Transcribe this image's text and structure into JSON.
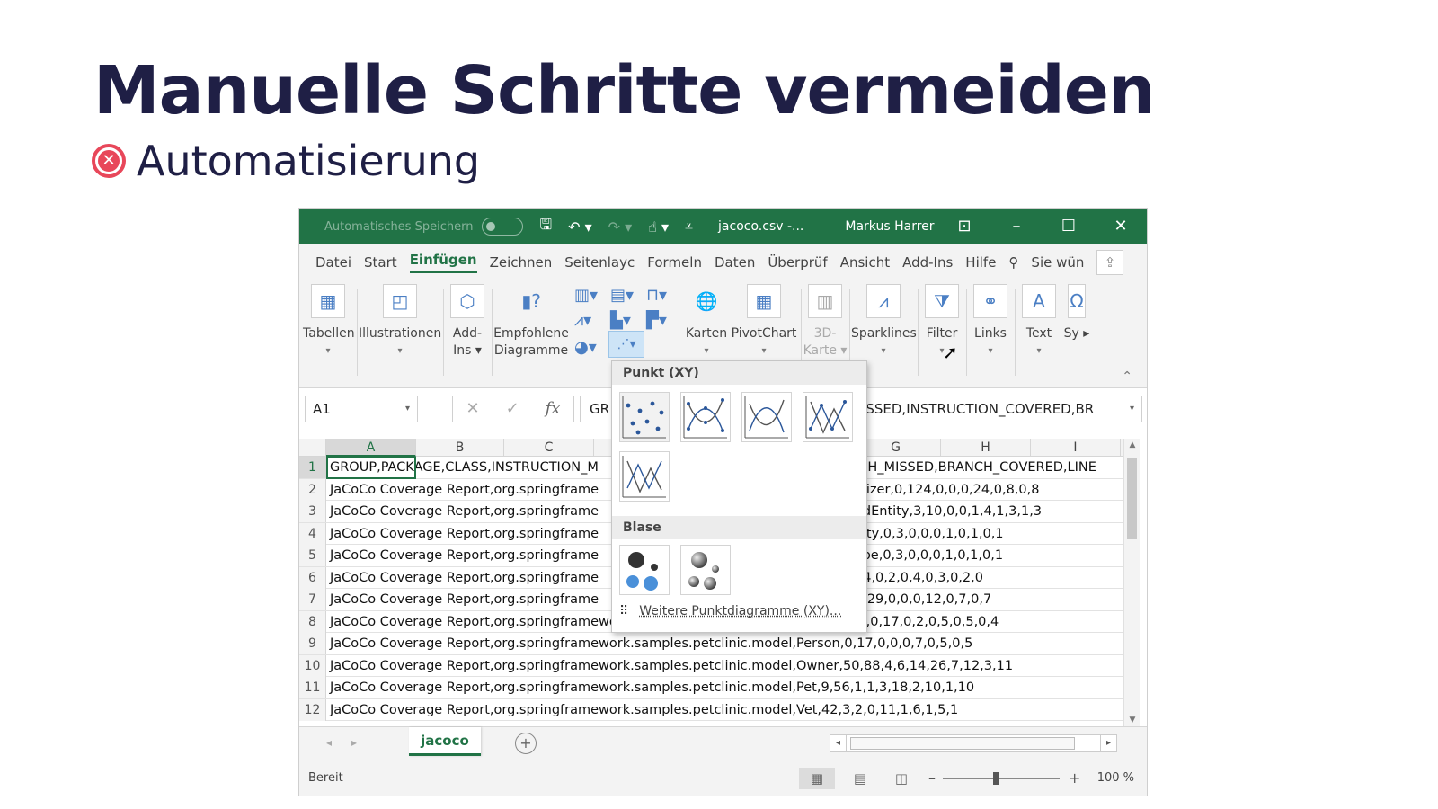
{
  "slide": {
    "title": "Manuelle Schritte vermeiden",
    "subtitle": "Automatisierung",
    "subtitle_icon": "x-circle-icon",
    "accent_color": "#e8475a",
    "title_color": "#1f1f45"
  },
  "excel": {
    "titlebar": {
      "autosave_label": "Automatisches Speichern",
      "filename": "jacoco.csv -...",
      "user": "Markus Harrer",
      "color": "#217346"
    },
    "menu": [
      "Datei",
      "Start",
      "Einfügen",
      "Zeichnen",
      "Seitenlayc",
      "Formeln",
      "Daten",
      "Überprüf",
      "Ansicht",
      "Add-Ins",
      "Hilfe"
    ],
    "menu_active": "Einfügen",
    "search_label": "Sie wün",
    "ribbon": {
      "tables": "Tabellen",
      "illustrations": "Illustrationen",
      "addins_1": "Add-",
      "addins_2": "Ins",
      "recommended_1": "Empfohlene",
      "recommended_2": "Diagramme",
      "maps": "Karten",
      "pivotchart": "PivotChart",
      "map3d_1": "3D-",
      "map3d_2": "Karte",
      "sparklines": "Sparklines",
      "filter": "Filter",
      "links": "Links",
      "text": "Text",
      "symbols": "Sy"
    },
    "namebox": "A1",
    "formula_left": "GR",
    "formula_right": "MISSED,INSTRUCTION_COVERED,BR",
    "columns": [
      "A",
      "B",
      "C",
      "G",
      "H",
      "I"
    ],
    "rows": [
      {
        "n": "1",
        "left": "GROUP,PACKAGE,CLASS,INSTRUCTION_M",
        "right": "ICH_MISSED,BRANCH_COVERED,LINE"
      },
      {
        "n": "2",
        "left": "JaCoCo Coverage Report,org.springframe",
        "right": "alizer,0,124,0,0,0,24,0,8,0,8"
      },
      {
        "n": "3",
        "left": "JaCoCo Coverage Report,org.springframe",
        "right": "edEntity,3,10,0,0,1,4,1,3,1,3"
      },
      {
        "n": "4",
        "left": "JaCoCo Coverage Report,org.springframe",
        "right": "alty,0,3,0,0,0,1,0,1,0,1"
      },
      {
        "n": "5",
        "left": "JaCoCo Coverage Report,org.springframe",
        "right": "ype,0,3,0,0,0,1,0,1,0,1"
      },
      {
        "n": "6",
        "left": "JaCoCo Coverage Report,org.springframe",
        "right": "14,0,2,0,4,0,3,0,2,0"
      },
      {
        "n": "7",
        "left": "JaCoCo Coverage Report,org.springframe",
        "right": "0,29,0,0,0,12,0,7,0,7"
      },
      {
        "n": "8",
        "left": "JaCoCo Coverage Report,org.springframework.samples.petclinic.model,BaseEntity,0,17,0,2,0,5,0,5,0,4",
        "right": ""
      },
      {
        "n": "9",
        "left": "JaCoCo Coverage Report,org.springframework.samples.petclinic.model,Person,0,17,0,0,0,7,0,5,0,5",
        "right": ""
      },
      {
        "n": "10",
        "left": "JaCoCo Coverage Report,org.springframework.samples.petclinic.model,Owner,50,88,4,6,14,26,7,12,3,11",
        "right": ""
      },
      {
        "n": "11",
        "left": "JaCoCo Coverage Report,org.springframework.samples.petclinic.model,Pet,9,56,1,1,3,18,2,10,1,10",
        "right": ""
      },
      {
        "n": "12",
        "left": "JaCoCo Coverage Report,org.springframework.samples.petclinic.model,Vet,42,3,2,0,11,1,6,1,5,1",
        "right": ""
      }
    ],
    "sheet_tab": "jacoco",
    "status_ready": "Bereit",
    "zoom": "100 %",
    "dropdown": {
      "section_scatter": "Punkt (XY)",
      "section_bubble": "Blase",
      "more_label": "Weitere Punktdiagramme (XY)..."
    }
  }
}
